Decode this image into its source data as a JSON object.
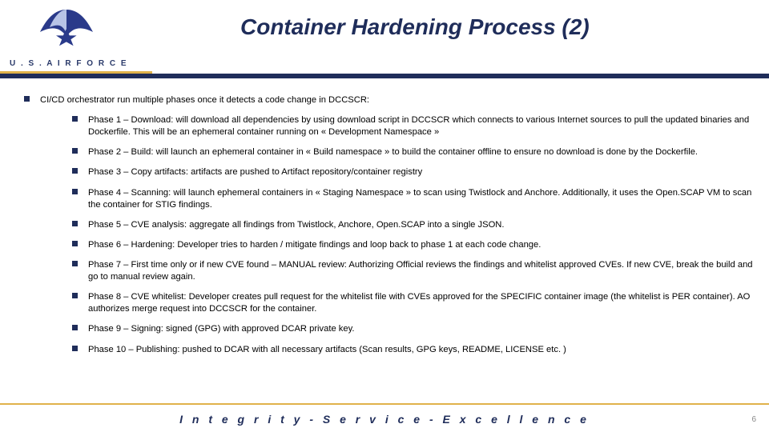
{
  "header": {
    "org": "U . S .  A I R  F O R C E",
    "title": "Container Hardening Process (2)"
  },
  "main": {
    "lead": "CI/CD orchestrator run multiple phases once it detects a code change in DCCSCR:",
    "phases": [
      "Phase 1 – Download: will download all dependencies by using download script in DCCSCR which connects to various Internet sources to pull the updated binaries and Dockerfile. This will be an ephemeral container running on « Development Namespace »",
      "Phase 2 – Build: will launch an ephemeral container in « Build namespace » to build the container offline to ensure no download is done by the Dockerfile.",
      "Phase 3 – Copy artifacts: artifacts are pushed to Artifact repository/container registry",
      "Phase 4 – Scanning: will launch ephemeral containers in « Staging Namespace » to scan using Twistlock and Anchore. Additionally, it uses the Open.SCAP VM to scan the container for STIG findings.",
      "Phase 5 – CVE analysis: aggregate all findings from Twistlock, Anchore, Open.SCAP into a single JSON.",
      "Phase 6 – Hardening: Developer tries to harden / mitigate findings and loop back to phase 1 at each code change.",
      "Phase 7 – First time only or if new CVE found – MANUAL review: Authorizing Official reviews the findings and whitelist approved CVEs. If new CVE, break the build and go to manual review again.",
      "Phase 8 – CVE whitelist: Developer creates pull request for the whitelist file with CVEs approved for the SPECIFIC container image (the whitelist is PER container). AO authorizes merge request into DCCSCR for the container.",
      "Phase 9 – Signing: signed (GPG) with approved DCAR private key.",
      "Phase 10 – Publishing: pushed to DCAR with all necessary artifacts (Scan results, GPG keys, README, LICENSE etc. )"
    ]
  },
  "footer": {
    "motto": "I n t e g r i t y  -  S e r v i c e  -  E x c e l l e n c e",
    "page": "6"
  },
  "colors": {
    "navy": "#1f2d5a",
    "gold": "#e0b24a"
  }
}
